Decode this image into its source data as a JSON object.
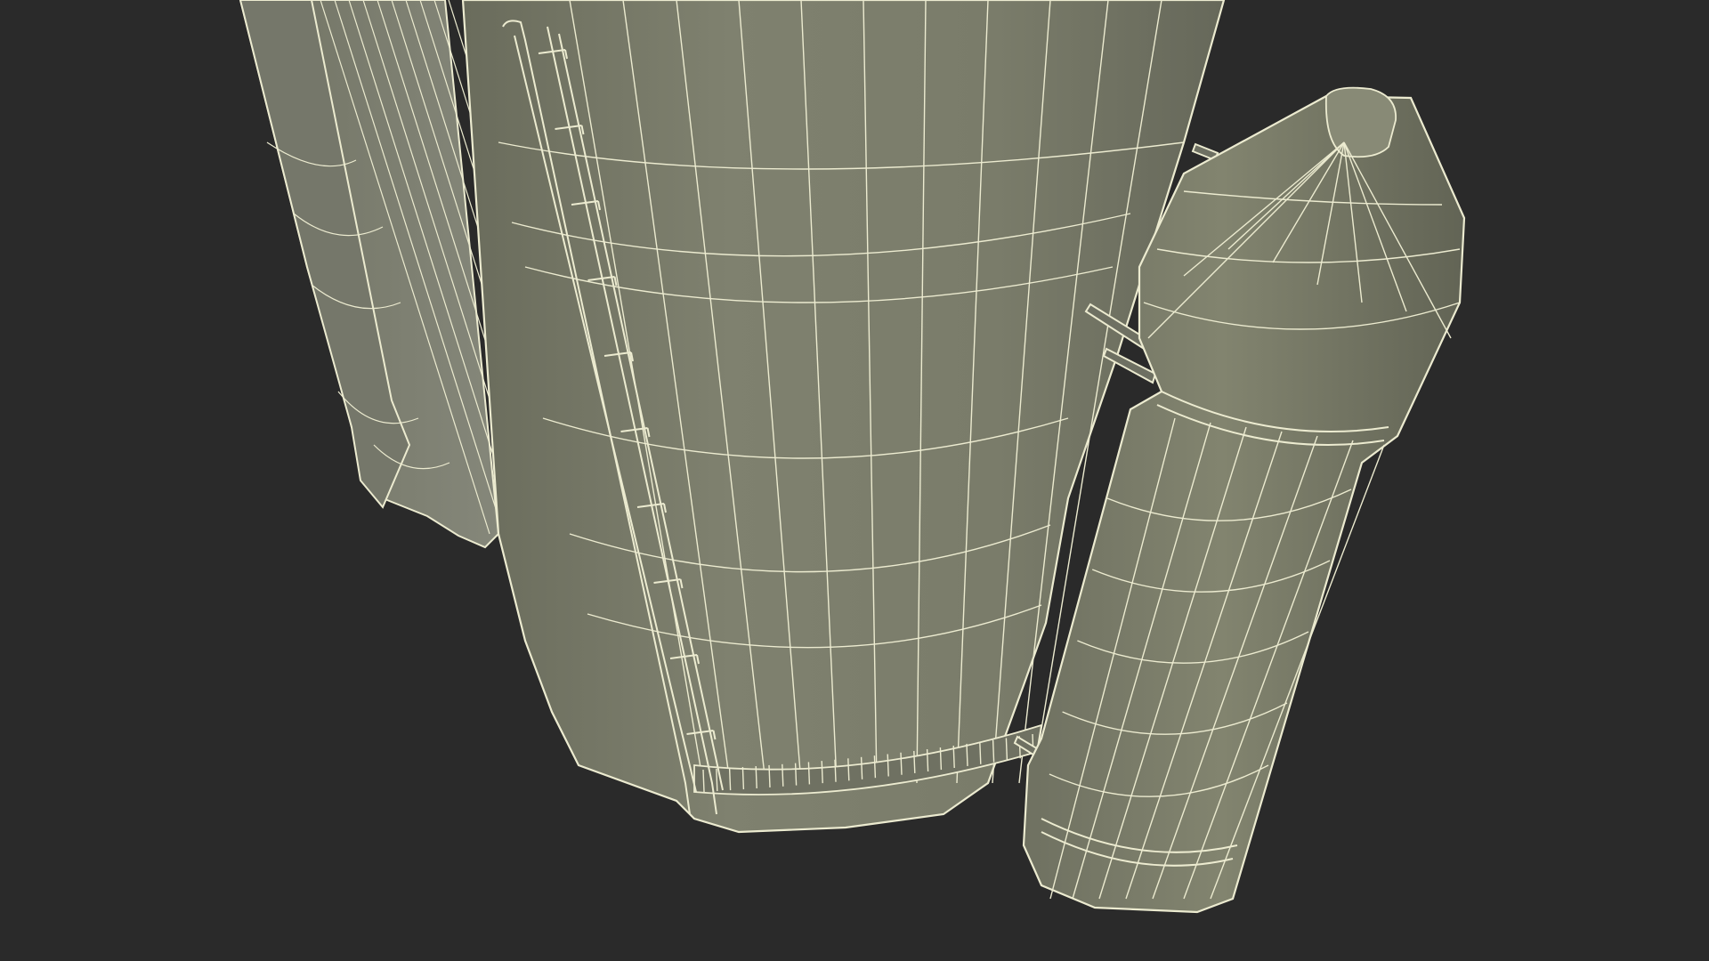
{
  "viewport": {
    "background_color": "#2a2a2a"
  },
  "model": {
    "surface_color": "#7d7f6d",
    "shadow_color": "#5f6152",
    "highlight_color": "#8c8e7b",
    "wire_color": "#ecebd0",
    "render_mode": "wireframe-on-shaded"
  }
}
